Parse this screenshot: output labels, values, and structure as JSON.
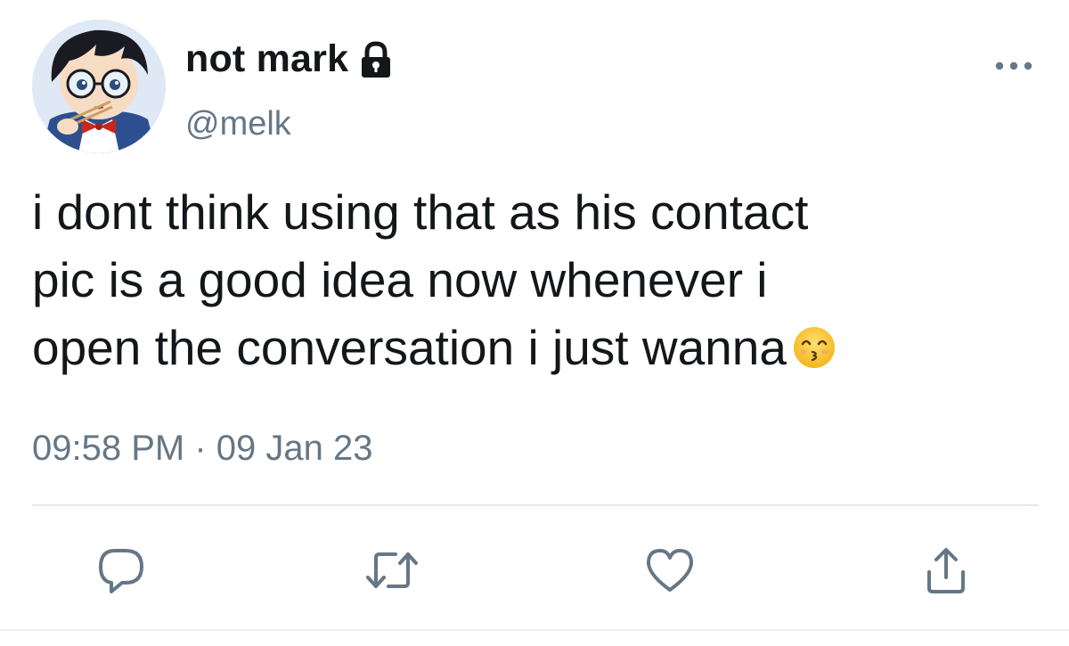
{
  "tweet": {
    "author": {
      "display_name": "not mark",
      "handle": "@melk",
      "protected_icon": "lock-icon",
      "avatar": "anime-character-avatar"
    },
    "more_icon": "more-horizontal-icon",
    "text_line_1": "i dont think using that as his contact",
    "text_line_2": "pic is a good idea now whenever i",
    "text_line_3": "open the conversation i just wanna",
    "text_emoji": "kissing-smiling-eyes-emoji",
    "time": "09:58 PM",
    "separator": "·",
    "date": "09 Jan 23",
    "actions": [
      {
        "icon": "reply-icon"
      },
      {
        "icon": "retweet-icon"
      },
      {
        "icon": "like-icon"
      },
      {
        "icon": "share-icon"
      }
    ],
    "colors": {
      "text": "#14171a",
      "secondary": "#657786",
      "divider": "#e1e8ed"
    }
  }
}
